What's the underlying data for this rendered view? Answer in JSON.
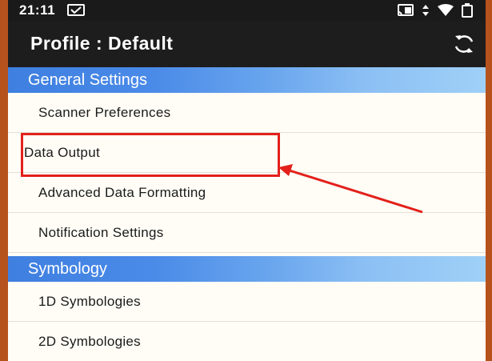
{
  "status_bar": {
    "time": "21:11",
    "icons": [
      "screen-cast-icon",
      "data-arrows-icon",
      "wifi-icon",
      "battery-icon"
    ]
  },
  "app_bar": {
    "title": "Profile : Default",
    "refresh_icon": "refresh-icon"
  },
  "sections": [
    {
      "header": "General Settings",
      "items": [
        {
          "label": "Scanner Preferences"
        },
        {
          "label": "Data Output"
        },
        {
          "label": "Advanced Data Formatting"
        },
        {
          "label": "Notification Settings"
        }
      ]
    },
    {
      "header": "Symbology",
      "items": [
        {
          "label": "1D Symbologies"
        },
        {
          "label": "2D Symbologies"
        }
      ]
    }
  ],
  "annotation": {
    "highlight_color": "#e3201b"
  },
  "colors": {
    "frame": "#b6531d",
    "app_bar": "#1d1d1d",
    "section_header_start": "#3e7fe0",
    "section_header_end": "#9fd0f7",
    "list_background": "#fffdf6"
  }
}
